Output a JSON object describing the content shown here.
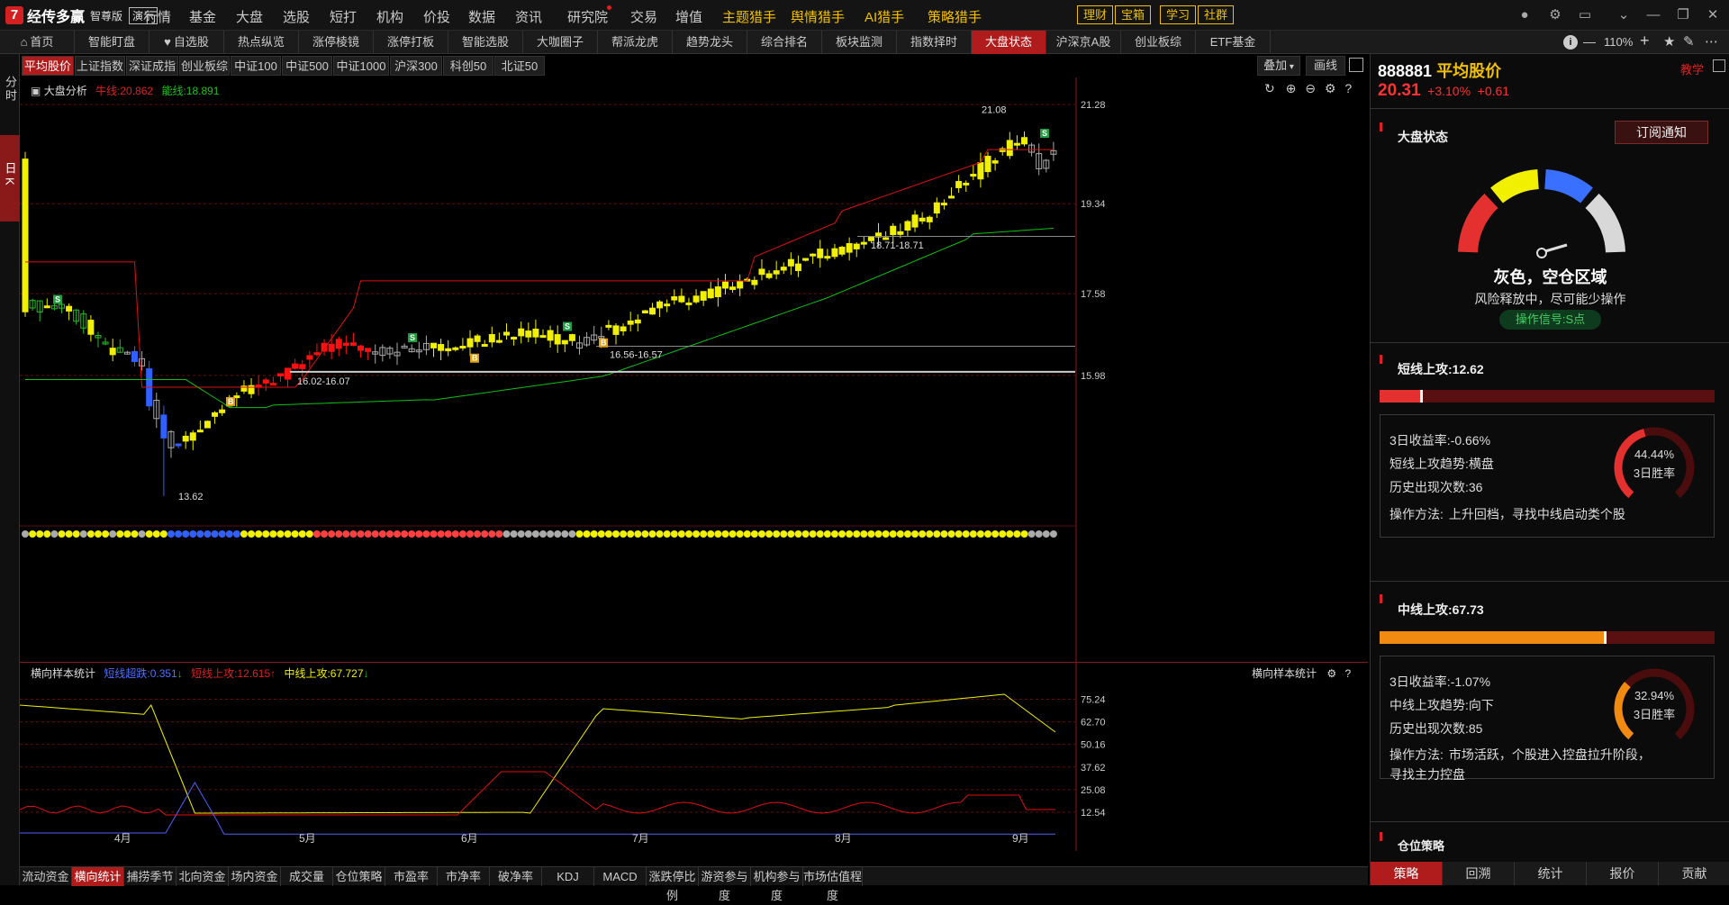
{
  "app": {
    "logo_mark": "7",
    "name": "经传多赢",
    "edition": "智尊版",
    "demo": "演示"
  },
  "menu": [
    "行情",
    "基金",
    "大盘",
    "选股",
    "短打",
    "机构",
    "价投",
    "数据",
    "资讯",
    "研究院",
    "交易",
    "增值",
    "主题猎手",
    "舆情猎手",
    "AI猎手",
    "策略猎手"
  ],
  "top_buttons": [
    "理财",
    "宝箱",
    "学习",
    "社群"
  ],
  "nav_tabs": [
    "首页",
    "智能盯盘",
    "自选股",
    "热点纵览",
    "涨停棱镜",
    "涨停打板",
    "智能选股",
    "大咖圈子",
    "帮派龙虎",
    "趋势龙头",
    "综合排名",
    "板块监测",
    "指数择时",
    "大盘状态",
    "沪深京A股",
    "创业板综",
    "ETF基金"
  ],
  "zoom": "110%",
  "left_tabs": {
    "fen": "分时",
    "ri": "日K"
  },
  "index_tabs": [
    "平均股价",
    "上证指数",
    "深证成指",
    "创业板综",
    "中证100",
    "中证500",
    "中证1000",
    "沪深300",
    "科创50",
    "北证50"
  ],
  "chart_toolbar": {
    "overlay": "叠加",
    "draw": "画线"
  },
  "legend": {
    "name": "大盘分析",
    "niu_label": "牛线:20.862",
    "neng_label": "能线:18.891"
  },
  "colors": {
    "bull": "#e01010",
    "energy": "#10c010",
    "yellow": "#f0f000",
    "red_candle": "#ff1010",
    "blue": "#3060ff",
    "green": "#20c020",
    "gray": "#aaaaaa"
  },
  "price_axis": [
    "21.28",
    "19.34",
    "17.58",
    "15.98"
  ],
  "chart_annotations": [
    "21.08",
    "18.71-18.71",
    "16.56-16.57",
    "16.02-16.07",
    "13.62"
  ],
  "date_labels": [
    "4月",
    "5月",
    "6月",
    "7月",
    "8月",
    "9月"
  ],
  "lower_panel": {
    "title": "横向样本统计",
    "right_title": "横向样本统计",
    "short_over": "短线超跌:0.351",
    "short_up": "短线上攻:12.615",
    "mid_up": "中线上攻:67.727",
    "axis": [
      "75.24",
      "62.70",
      "50.16",
      "37.62",
      "25.08",
      "12.54"
    ]
  },
  "bottom_tabs": [
    "流动资金",
    "横向统计",
    "捕捞季节",
    "北向资金",
    "场内资金",
    "成交量",
    "仓位策略",
    "市盈率",
    "市净率",
    "破净率",
    "KDJ",
    "MACD",
    "涨跌停比例",
    "游资参与度",
    "机构参与度",
    "市场估值程度"
  ],
  "chart_data": {
    "type": "candlestick",
    "title": "888881 平均股价",
    "y_range": [
      13.0,
      21.6
    ],
    "annotated_levels": {
      "high": 21.08,
      "low": 13.62
    },
    "indicators": {
      "niu_line": 20.862,
      "neng_line": 18.891
    },
    "months": [
      "4月",
      "5月",
      "6月",
      "7月",
      "8月",
      "9月"
    ],
    "lower_series": {
      "短线超跌": 0.351,
      "短线上攻": 12.615,
      "中线上攻": 67.727
    }
  },
  "right_panel": {
    "code": "888881",
    "name": "平均股价",
    "teach": "教学",
    "price": "20.31",
    "change_pct": "+3.10%",
    "change": "+0.61",
    "market_state_title": "大盘状态",
    "subscribe": "订阅通知",
    "state_main": "灰色，空仓区域",
    "state_sub": "风险释放中，尽可能少操作",
    "signal": "操作信号:S点",
    "short": {
      "title": "短线上攻:12.62",
      "bar_fraction": 0.13,
      "ret": "3日收益率:",
      "ret_val": "-0.66%",
      "trend": "短线上攻趋势:",
      "trend_val": "横盘",
      "count": "历史出现次数:",
      "count_val": "36",
      "method": "操作方法:",
      "method_val": "上升回档，寻找中线启动类个股",
      "win": "44.44%",
      "win_fraction": 0.4444,
      "win_label": "3日胜率"
    },
    "mid": {
      "title": "中线上攻:67.73",
      "bar_fraction": 0.6773,
      "ret": "3日收益率:",
      "ret_val": "-1.07%",
      "trend": "中线上攻趋势:",
      "trend_val": "向下",
      "count": "历史出现次数:",
      "count_val": "85",
      "method": "操作方法:",
      "method_val": "市场活跃，个股进入控盘拉升阶段，寻找主力控盘",
      "win": "32.94%",
      "win_fraction": 0.3294,
      "win_label": "3日胜率"
    },
    "position_title": "仓位策略",
    "tabs": [
      "策略",
      "回溯",
      "统计",
      "报价",
      "贡献"
    ]
  }
}
